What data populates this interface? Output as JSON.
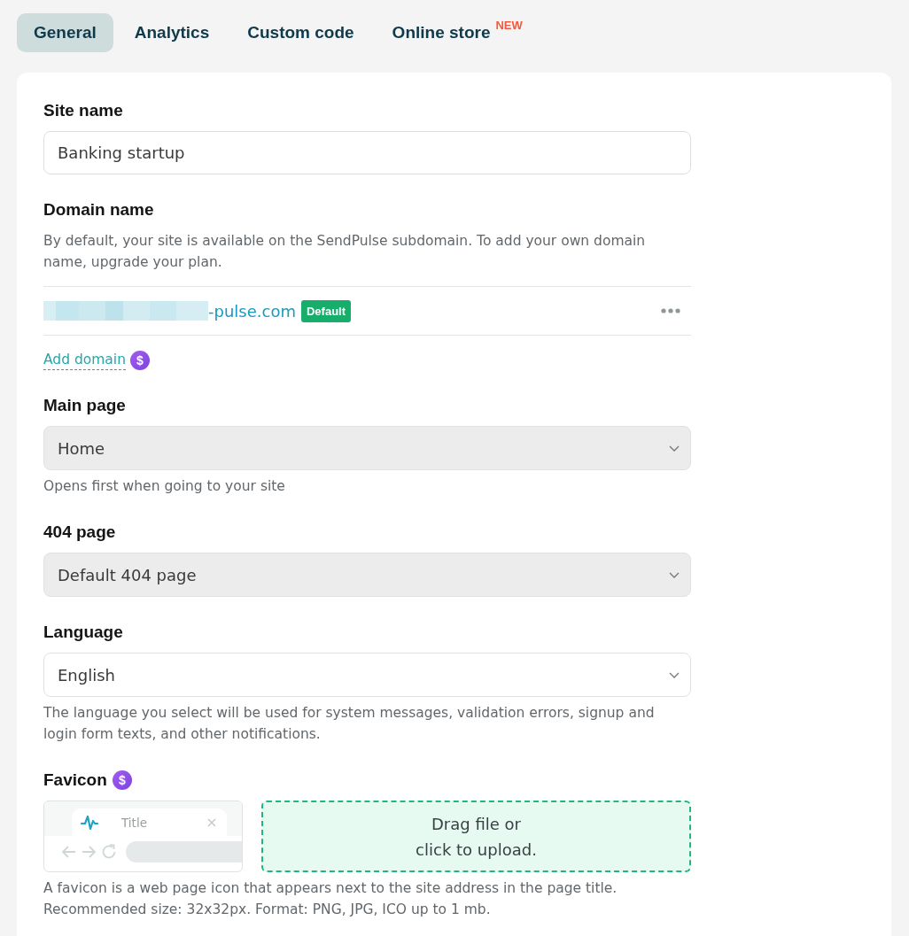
{
  "tabs": [
    {
      "label": "General",
      "selected": true
    },
    {
      "label": "Analytics",
      "selected": false
    },
    {
      "label": "Custom code",
      "selected": false
    },
    {
      "label": "Online store",
      "selected": false,
      "badge": "NEW"
    }
  ],
  "fields": [
    {
      "kind": "text",
      "label": "Site name",
      "value": "Banking startup"
    },
    {
      "kind": "domain",
      "label": "Domain name",
      "description": "By default, your site is available on the SendPulse subdomain. To add your own domain name, upgrade your plan.",
      "domains": [
        {
          "redacted": true,
          "name": "-pulse.com",
          "badge": "Default"
        }
      ],
      "add_link": "Add domain",
      "paid_mark": "$"
    },
    {
      "kind": "select",
      "label": "Main page",
      "value": "Home",
      "disabled": true,
      "help": "Opens first when going to your site"
    },
    {
      "kind": "select",
      "label": "404 page",
      "value": "Default 404 page",
      "disabled": true
    },
    {
      "kind": "select",
      "label": "Language",
      "value": "English",
      "disabled": false,
      "help": "The language you select will be used for system messages, validation errors, signup and login form texts, and other notifications."
    },
    {
      "kind": "favicon",
      "label": "Favicon",
      "paid_mark": "$",
      "preview": {
        "tab_title": "Title"
      },
      "upload_text": "Drag file or\nclick to upload.",
      "help": "A favicon is a web page icon that appears next to the site address in the page title. Recommended size: 32x32px. Format: PNG, JPG, ICO up to 1 mb."
    }
  ]
}
